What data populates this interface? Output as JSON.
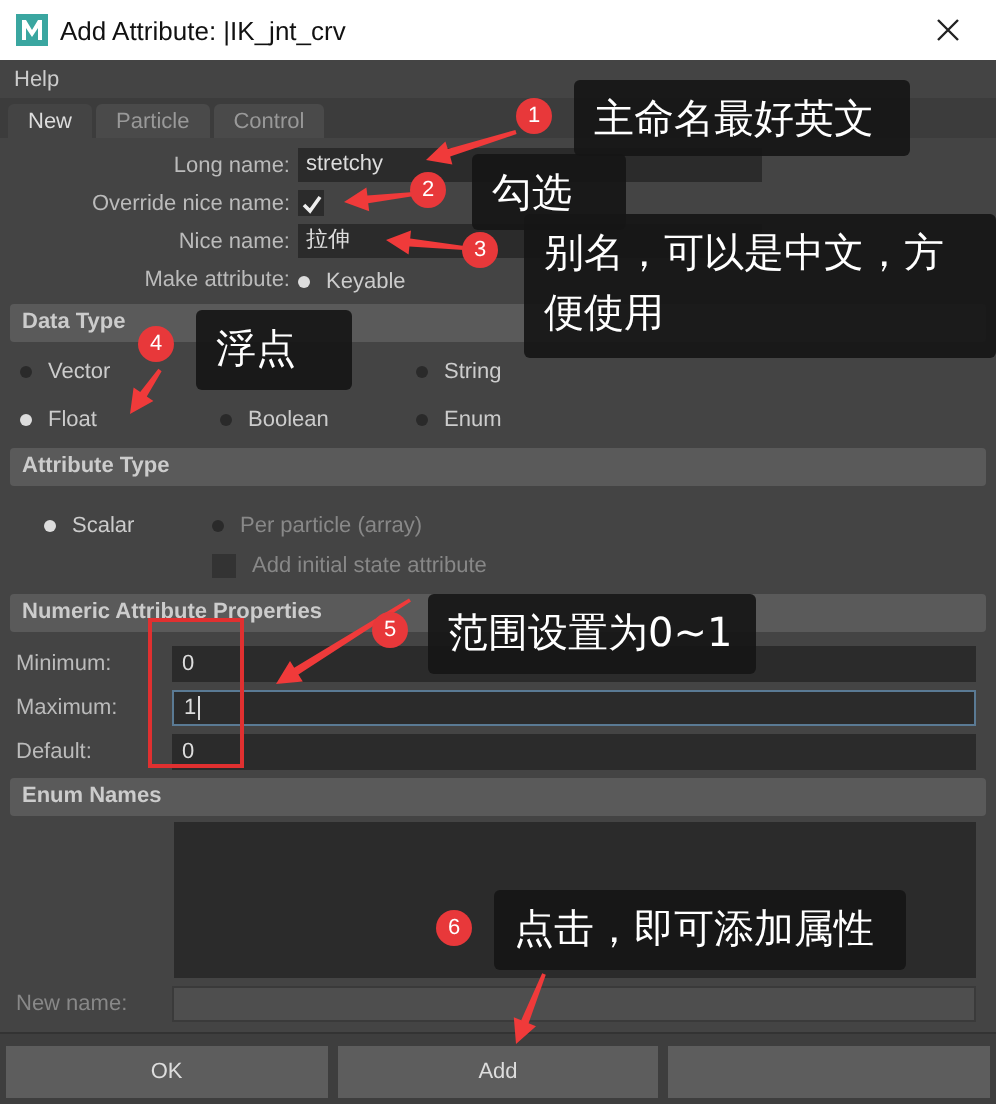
{
  "window": {
    "title": "Add Attribute: |IK_jnt_crv"
  },
  "menu": [
    "Help"
  ],
  "tabs": [
    {
      "label": "New",
      "selected": true
    },
    {
      "label": "Particle",
      "selected": false
    },
    {
      "label": "Control",
      "selected": false
    }
  ],
  "form": {
    "long_name": {
      "label": "Long name:",
      "value": "stretchy"
    },
    "override": {
      "label": "Override nice name:",
      "checked": true
    },
    "nice_name": {
      "label": "Nice name:",
      "value": "拉伸"
    },
    "make_attribute": {
      "label": "Make attribute:",
      "options": [
        {
          "label": "Keyable",
          "selected": true
        }
      ]
    }
  },
  "data_type": {
    "title": "Data Type",
    "options": [
      {
        "label": "Vector",
        "selected": false
      },
      {
        "label": "String",
        "selected": false
      },
      {
        "label": "Float",
        "selected": true
      },
      {
        "label": "Boolean",
        "selected": false
      },
      {
        "label": "Enum",
        "selected": false
      }
    ]
  },
  "attribute_type": {
    "title": "Attribute Type",
    "options": [
      {
        "label": "Scalar",
        "selected": true,
        "disabled": false
      },
      {
        "label": "Per particle (array)",
        "selected": false,
        "disabled": true
      }
    ],
    "initial_state": {
      "label": "Add initial state attribute",
      "checked": false,
      "disabled": true
    }
  },
  "numeric": {
    "title": "Numeric Attribute Properties",
    "fields": [
      {
        "label": "Minimum:",
        "value": "0",
        "focused": false
      },
      {
        "label": "Maximum:",
        "value": "1",
        "focused": true
      },
      {
        "label": "Default:",
        "value": "0",
        "focused": false
      }
    ]
  },
  "enum": {
    "title": "Enum Names",
    "new_name_label": "New name:"
  },
  "buttons": [
    {
      "label": "OK"
    },
    {
      "label": "Add"
    }
  ],
  "annotations": [
    {
      "number": "1",
      "text": "主命名最好英文"
    },
    {
      "number": "2",
      "text": "勾选"
    },
    {
      "number": "3",
      "text": "别名，可以是中文，方便使用"
    },
    {
      "number": "4",
      "text": "浮点"
    },
    {
      "number": "5",
      "text": "范围设置为0~1"
    },
    {
      "number": "6",
      "text": "点击，即可添加属性"
    }
  ]
}
